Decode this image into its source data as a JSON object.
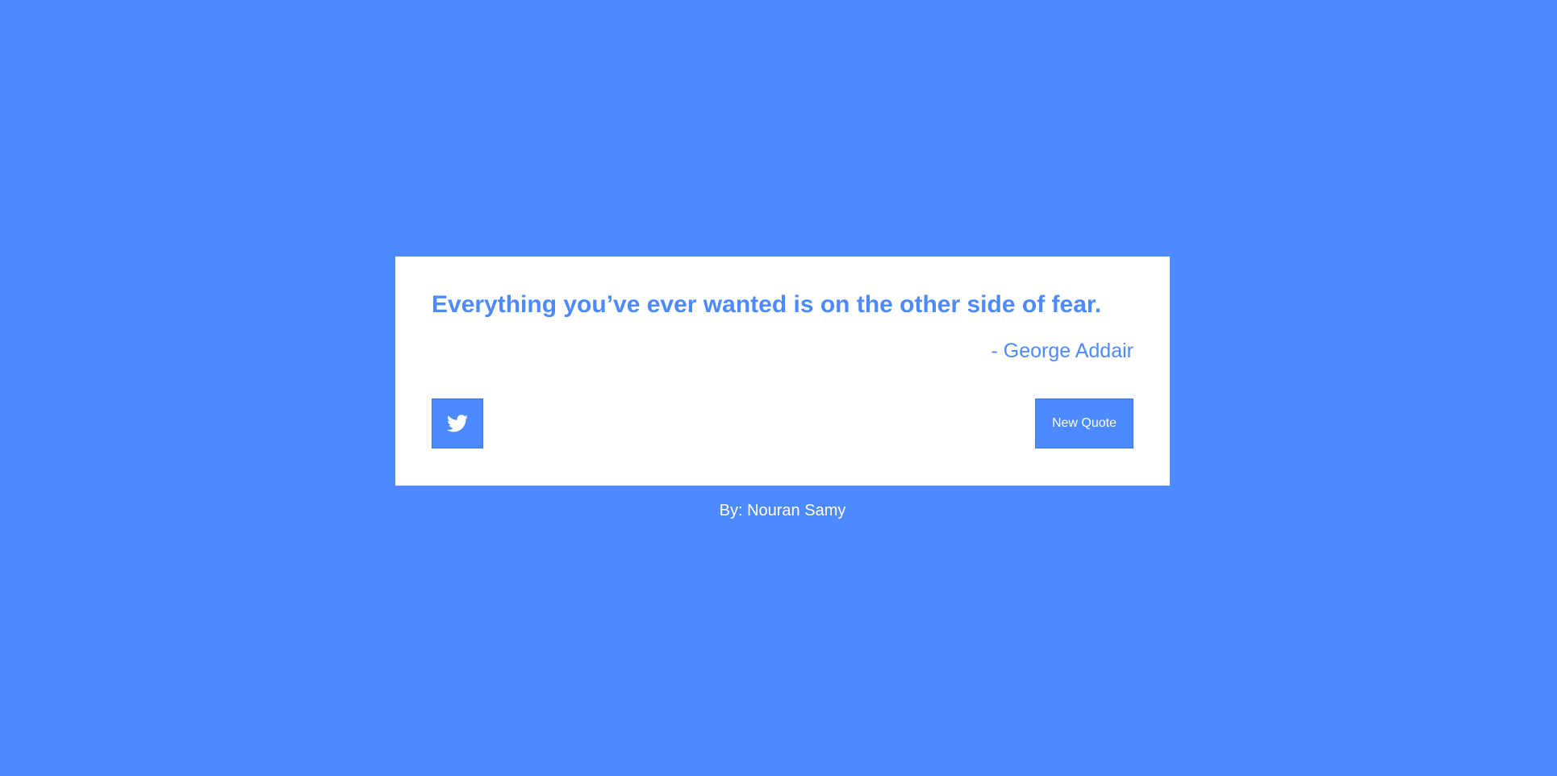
{
  "theme": {
    "background_color": "#4d89ff",
    "card_color": "#ffffff",
    "accent_color": "#4d89ff",
    "text_on_accent_color": "#ffffff"
  },
  "quote": {
    "text": "Everything you’ve ever wanted is on the other side of fear.",
    "author": "- George Addair"
  },
  "actions": {
    "tweet_icon": "twitter-bird-icon",
    "new_quote_label": "New Quote"
  },
  "footer": {
    "credit": "By: Nouran Samy"
  }
}
